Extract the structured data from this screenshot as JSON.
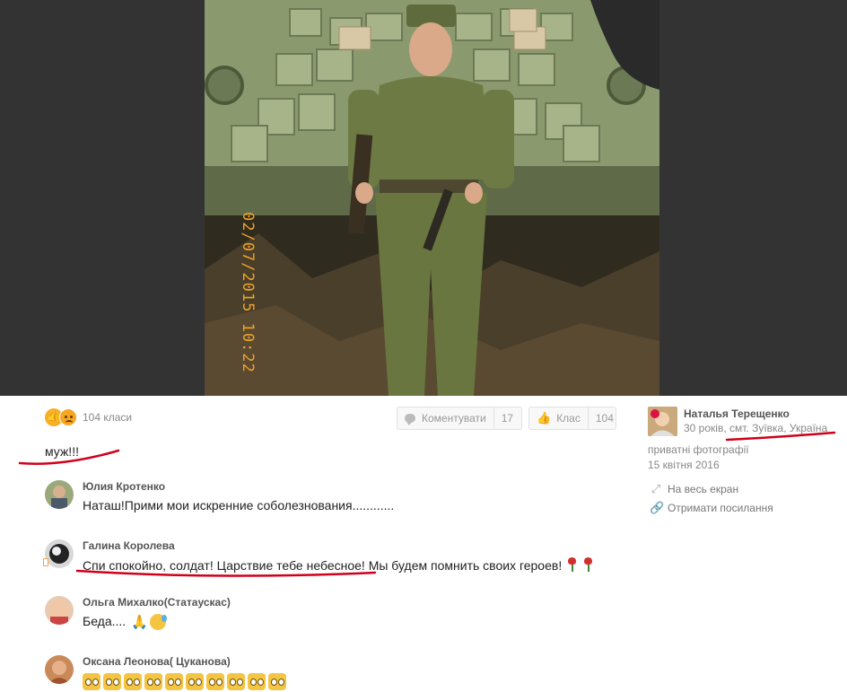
{
  "photo": {
    "timestamp": "02/07/2015 10:22"
  },
  "actions": {
    "classes_count": "104 класи",
    "comment_label": "Коментувати",
    "comment_count": "17",
    "like_label": "Клас",
    "like_count": "104"
  },
  "caption": "муж!!!",
  "comments": [
    {
      "name": "Юлия Кротенко",
      "text": "Наташ!Прими мои искренние соболезнования............"
    },
    {
      "name": "Галина Королева",
      "text": "Спи спокойно, солдат! Царствие тебе небесное! Мы будем помнить своих героев!"
    },
    {
      "name": "Ольга Михалко(Статаускас)",
      "text": "Беда...."
    },
    {
      "name": "Оксана Леонова( Цуканова)",
      "text": ""
    }
  ],
  "author": {
    "name": "Наталья Терещенко",
    "age": "30 років,",
    "location": "смт. Зуївка, Україна",
    "album": "приватні фотографії",
    "date": "15 квітня 2016"
  },
  "side_links": {
    "fullscreen": "На весь екран",
    "get_link": "Отримати посилання"
  },
  "icons": {
    "reaction_like": "thumbs-up-emoji",
    "reaction_sad": "sad-face-emoji",
    "comment_icon": "speech-bubble-icon",
    "like_icon": "thumbs-up-icon",
    "fullscreen_icon": "expand-arrows-icon",
    "link_icon": "chain-link-icon",
    "rose_icon": "rose-emoji",
    "pray_icon": "praying-hands-emoji",
    "sweat_icon": "sweat-face-emoji",
    "cat_icon": "crying-cat-emoji"
  },
  "colors": {
    "photo_backdrop": "#333333",
    "annotation_red": "#d0001b",
    "timestamp_orange": "#f0a328"
  }
}
